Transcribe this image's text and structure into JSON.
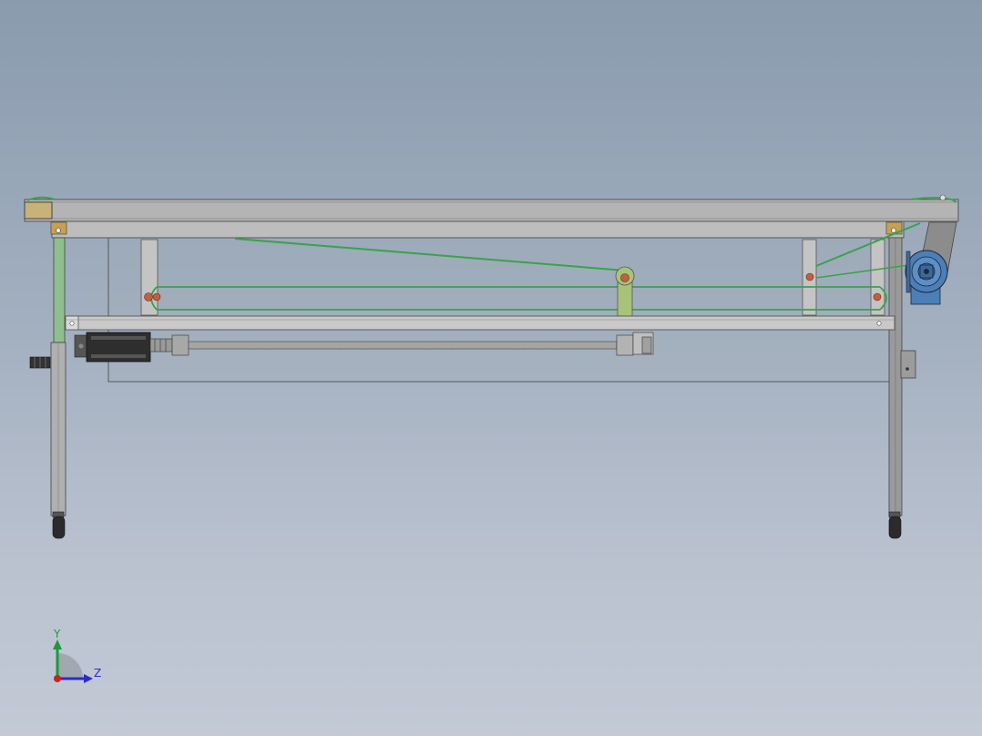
{
  "triad": {
    "y_label": "Y",
    "z_label": "Z",
    "y_color": "#1a9a3a",
    "z_color": "#2a2ad0",
    "x_color": "#d02020"
  },
  "colors": {
    "frame": "#b4b4b4",
    "frame_edge": "#555555",
    "belt": "#3aa24a",
    "bracket_gold": "#c8a050",
    "arm_green": "#a9c27a",
    "pin_red": "#c06040",
    "motor_blue": "#4a7fb8",
    "actuator_dark": "#3a3a3a",
    "cover_gray": "#8c8c8c"
  }
}
